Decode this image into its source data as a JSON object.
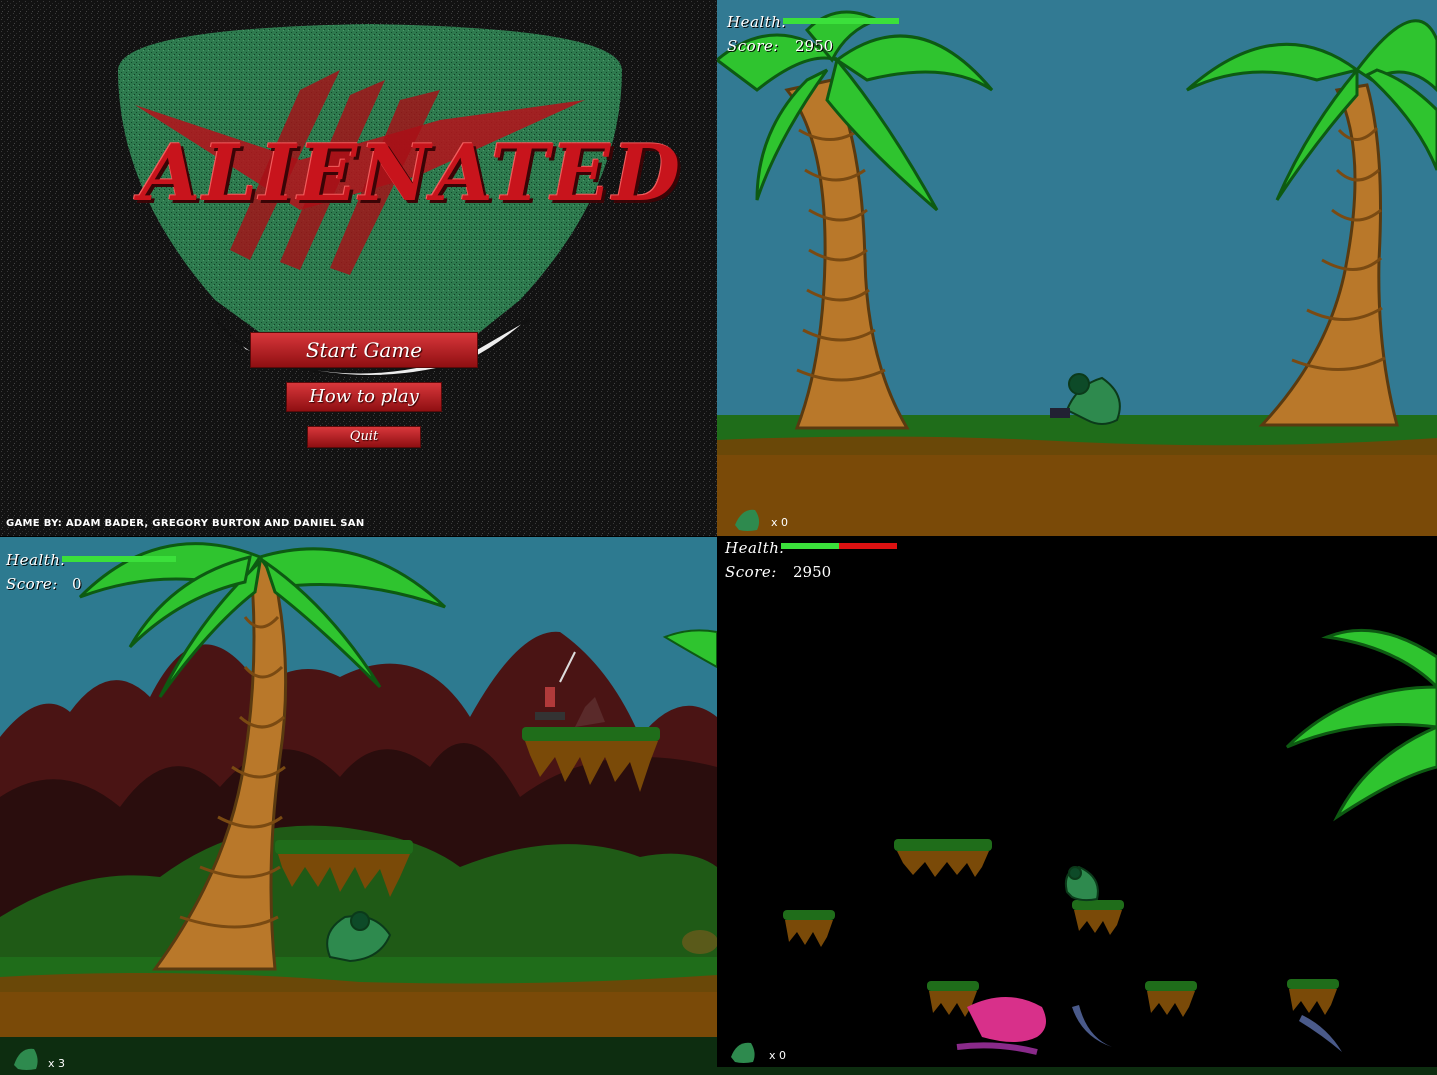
{
  "title_screen": {
    "title": "ALIENATED",
    "menu": {
      "start_label": "Start Game",
      "how_label": "How to play",
      "quit_label": "Quit"
    },
    "credits": "GAME BY: ADAM BADER, GREGORY BURTON AND DANIEL SAN"
  },
  "scene_top_right": {
    "hud": {
      "health_label": "Health:",
      "score_label": "Score:",
      "score_value": "2950",
      "health_fraction": 1.0
    },
    "lives": "x 0"
  },
  "scene_bottom_left": {
    "hud": {
      "health_label": "Health:",
      "score_label": "Score:",
      "score_value": "0",
      "health_fraction": 1.0
    },
    "lives": "x 3"
  },
  "scene_bottom_right": {
    "hud": {
      "health_label": "Health:",
      "score_label": "Score:",
      "score_value": "2950",
      "health_fraction": 0.5
    },
    "lives": "x 0"
  },
  "colors": {
    "health_full": "#3be03b",
    "health_empty": "#dd1111",
    "sky": "#327a93",
    "grass": "#1f6d1a",
    "dirt": "#7a4a08",
    "palm_leaf": "#2fc42f",
    "palm_trunk": "#b9782a"
  }
}
